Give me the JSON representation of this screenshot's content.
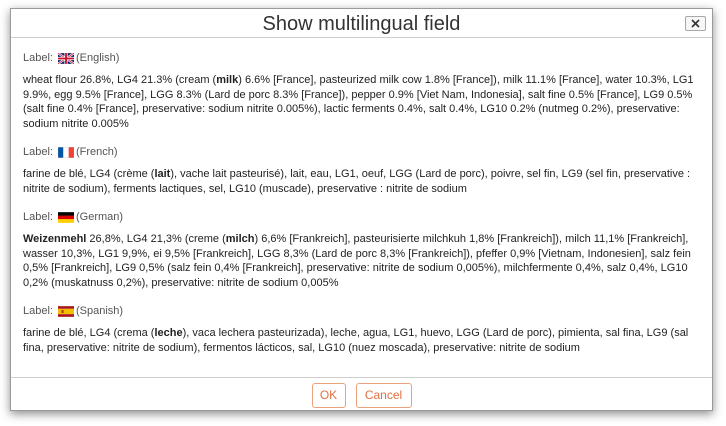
{
  "dialog": {
    "title": "Show multilingual field",
    "ok_label": "OK",
    "cancel_label": "Cancel"
  },
  "fields": [
    {
      "label": "Label:",
      "flag_icon": "uk-flag-icon",
      "language": "(English)",
      "segments": [
        {
          "t": "wheat flour 26.8%, LG4 21.3% (cream ("
        },
        {
          "t": "milk",
          "b": true
        },
        {
          "t": ") 6.6% [France], pasteurized milk cow 1.8% [France]), milk 11.1% [France], water 10.3%, LG1 9.9%, egg 9.5% [France], LGG 8.3% (Lard de porc 8.3% [France]), pepper 0.9% [Viet Nam, Indonesia], salt fine 0.5% [France], LG9 0.5% (salt fine 0.4% [France], preservative: sodium nitrite 0.005%), lactic ferments 0.4%, salt 0.4%, LG10 0.2% (nutmeg 0.2%), preservative: sodium nitrite 0.005%"
        }
      ]
    },
    {
      "label": "Label:",
      "flag_icon": "france-flag-icon",
      "language": "(French)",
      "segments": [
        {
          "t": "farine de blé, LG4 (crème ("
        },
        {
          "t": "lait",
          "b": true
        },
        {
          "t": "), vache lait pasteurisé), lait, eau, LG1, oeuf, LGG (Lard de porc), poivre, sel fin, LG9 (sel fin, preservative : nitrite de sodium), ferments lactiques, sel, LG10 (muscade), preservative : nitrite de sodium"
        }
      ]
    },
    {
      "label": "Label:",
      "flag_icon": "germany-flag-icon",
      "language": "(German)",
      "segments": [
        {
          "t": "Weizenmehl",
          "b": true
        },
        {
          "t": " 26,8%, LG4 21,3% (creme ("
        },
        {
          "t": "milch",
          "b": true
        },
        {
          "t": ") 6,6% [Frankreich], pasteurisierte milchkuh 1,8% [Frankreich]), milch 11,1% [Frankreich], wasser 10,3%, LG1 9,9%, ei 9,5% [Frankreich], LGG 8,3% (Lard de porc 8,3% [Frankreich]), pfeffer 0,9% [Vietnam, Indonesien], salz fein 0,5% [Frankreich], LG9 0,5% (salz fein 0,4% [Frankreich], preservative: nitrite de sodium 0,005%), milchfermente 0,4%, salz 0,4%, LG10 0,2% (muskatnuss 0,2%), preservative: nitrite de sodium 0,005%"
        }
      ]
    },
    {
      "label": "Label:",
      "flag_icon": "spain-flag-icon",
      "language": "(Spanish)",
      "segments": [
        {
          "t": "farine de blé, LG4 (crema ("
        },
        {
          "t": "leche",
          "b": true
        },
        {
          "t": "), vaca lechera pasteurizada), leche, agua, LG1, huevo, LGG (Lard de porc), pimienta, sal fina, LG9 (sal fina, preservative: nitrite de sodium), fermentos lácticos, sal, LG10 (nuez moscada), preservative: nitrite de sodium"
        }
      ]
    }
  ]
}
